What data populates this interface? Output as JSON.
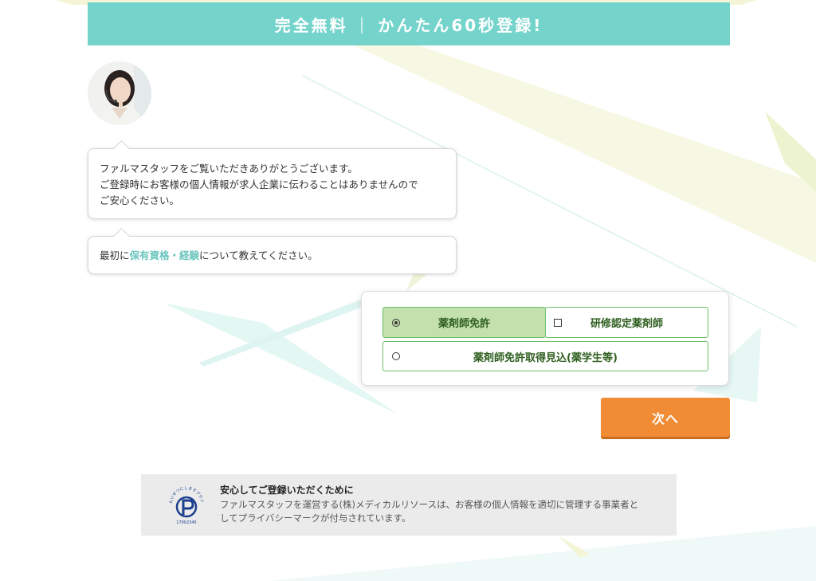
{
  "banner": {
    "left": "完全無料",
    "separator": "|",
    "right": "かんたん60秒登録!"
  },
  "chat": {
    "avatar_icon": "operator-avatar-icon",
    "message1": {
      "line1": "ファルマスタッフをご覧いただきありがとうございます。",
      "line2": "ご登録時にお客様の個人情報が求人企業に伝わることはありませんので",
      "line3": "ご安心ください。"
    },
    "message2": {
      "prefix": "最初に",
      "highlight": "保有資格・経験",
      "suffix": "について教えてください。"
    }
  },
  "options": [
    {
      "label": "薬剤師免許",
      "type": "radio",
      "selected": true
    },
    {
      "label": "研修認定薬剤師",
      "type": "checkbox",
      "selected": false
    },
    {
      "label": "薬剤師免許取得見込(薬学生等)",
      "type": "radio",
      "selected": false
    }
  ],
  "next_button": {
    "label": "次へ"
  },
  "privacy": {
    "title": "安心してご登録いただくために",
    "line1": "ファルマスタッフを運営する(株)メディカルリソースは、お客様の個人情報を適切に管理する事業者と",
    "line2": "してプライバシーマークが付与されています。",
    "mark_icon": "privacy-mark-icon",
    "mark_text_top": "たいせつにしますプライバシー",
    "mark_number": "17002345"
  },
  "colors": {
    "teal": "#74d3cb",
    "highlight": "#6cc6bf",
    "option_border": "#6bbd6b",
    "option_selected": "#c3e0ad",
    "button_orange": "#f08c35",
    "privacy_bg": "#ebebeb"
  }
}
